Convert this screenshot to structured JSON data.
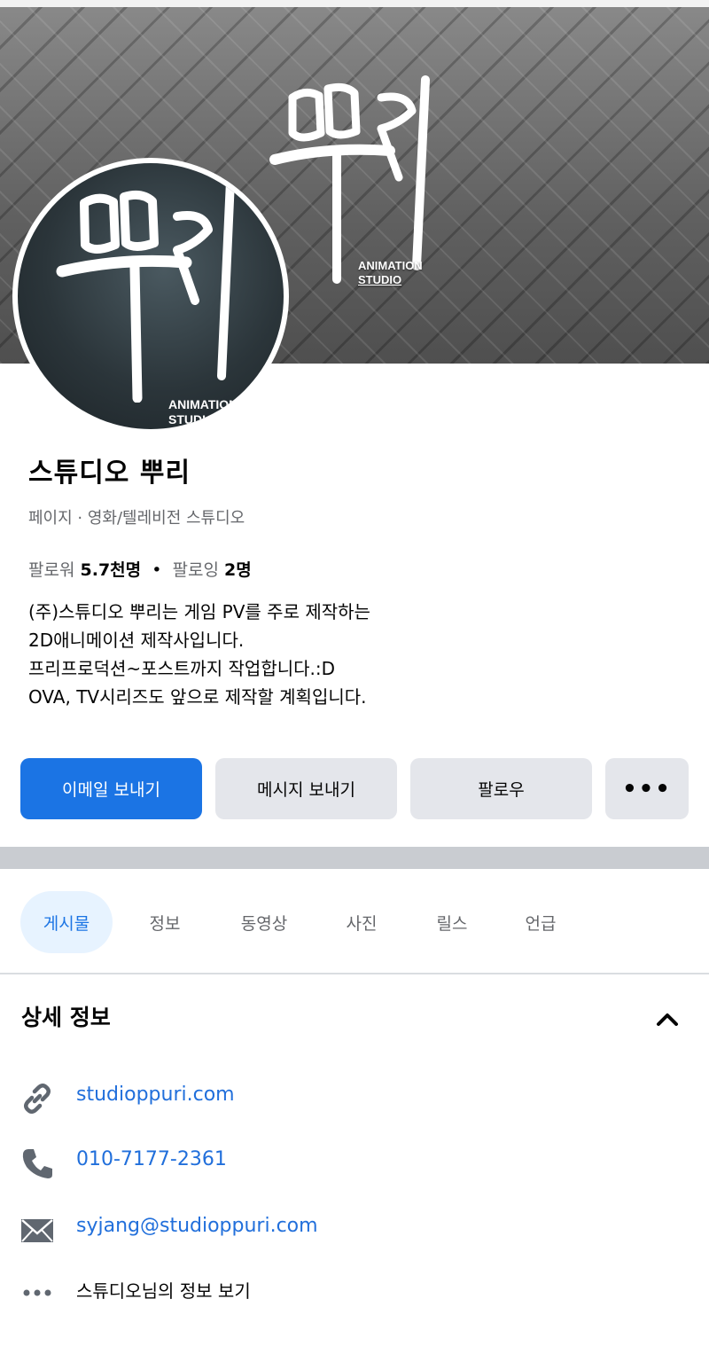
{
  "cover": {
    "studio_line1": "ANIMATION",
    "studio_line2": "STUDIO"
  },
  "avatar": {
    "studio_line1": "ANIMATION",
    "studio_line2": "STUDIO"
  },
  "profile": {
    "name": "스튜디오 뿌리",
    "category": "페이지 · 영화/텔레비전 스튜디오",
    "followers_label": "팔로워",
    "followers_value": "5.7천명",
    "separator": "•",
    "following_label": "팔로잉",
    "following_value": "2명",
    "bio": [
      "(주)스튜디오 뿌리는 게임 PV를 주로 제작하는",
      "2D애니메이션 제작사입니다.",
      "프리프로덕션~포스트까지 작업합니다.:D",
      "OVA, TV시리즈도 앞으로 제작할 계획입니다."
    ]
  },
  "actions": {
    "email": "이메일 보내기",
    "message": "메시지 보내기",
    "follow": "팔로우",
    "more": "•••"
  },
  "tabs": [
    "게시물",
    "정보",
    "동영상",
    "사진",
    "릴스",
    "언급"
  ],
  "details": {
    "title": "상세 정보",
    "website": "studioppuri.com",
    "phone": "010-7177-2361",
    "email": "syjang@studioppuri.com",
    "more_info": "스튜디오님의 정보 보기"
  },
  "colors": {
    "accent": "#1b74e4",
    "link": "#216fdb",
    "button_gray": "#e4e6eb",
    "muted_text": "#65676b"
  }
}
